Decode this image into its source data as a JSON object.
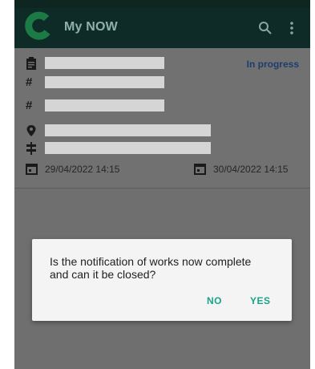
{
  "app": {
    "title": "My NOW"
  },
  "notification": {
    "status": "In progress",
    "start_date": "29/04/2022 14:15",
    "end_date": "30/04/2022 14:15"
  },
  "dialog": {
    "message": "Is the notification of works now complete and can it be closed?",
    "no_label": "NO",
    "yes_label": "YES"
  },
  "icons": [
    "logo-icon",
    "search-icon",
    "more-vert-icon",
    "clipboard-icon",
    "hash-icon",
    "location-pin-icon",
    "signpost-icon",
    "calendar-icon"
  ],
  "colors": {
    "appbar": "#0f2b28",
    "accent": "#18a38a",
    "status": "#1e3d6e",
    "scrim": "#6f6f6f"
  }
}
